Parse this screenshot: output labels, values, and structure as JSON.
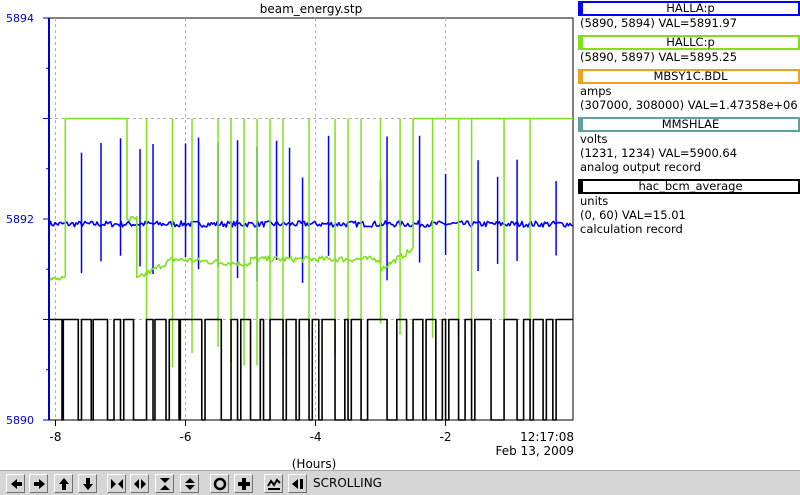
{
  "chart_data": {
    "type": "line",
    "title": "beam_energy.stp",
    "xlabel": "(Hours)",
    "x_ticks": [
      "-8",
      "-6",
      "-4",
      "-2"
    ],
    "y_ticks": [
      "5894",
      "5892",
      "5890"
    ],
    "ylim": [
      5890,
      5894
    ],
    "xlim": [
      -8.1,
      -0.04
    ],
    "grid": true,
    "time_label": "12:17:08",
    "date_label": "Feb 13, 2009",
    "axis_color": "#0000cc",
    "series": [
      {
        "name": "HALLA:p",
        "color": "#0000ff",
        "style": "noisy",
        "segments": [
          {
            "x": [
              -8.1,
              -0.04
            ],
            "y": [
              5891.95,
              5891.95
            ]
          }
        ],
        "spikes": [
          -7.6,
          -7.3,
          -7.0,
          -6.7,
          -6.5,
          -6.0,
          -5.8,
          -5.5,
          -5.2,
          -4.9,
          -4.6,
          -4.4,
          -4.2,
          -3.8,
          -3.0,
          -2.9,
          -2.4,
          -2.0,
          -1.5,
          -1.2,
          -0.9,
          -0.3
        ]
      },
      {
        "name": "HALLC:p",
        "color": "#80e020",
        "style": "noisy",
        "segments": [
          {
            "x": [
              -8.1,
              -7.85
            ],
            "y": [
              5891.4,
              5891.4
            ]
          },
          {
            "x": [
              -7.85,
              -6.9
            ],
            "y": [
              5893.0,
              5893.0
            ]
          },
          {
            "x": [
              -6.9,
              -6.75
            ],
            "y": [
              5892.0,
              5892.0
            ]
          },
          {
            "x": [
              -6.75,
              -6.2
            ],
            "y": [
              5891.4,
              5891.6
            ]
          },
          {
            "x": [
              -6.2,
              -5.0
            ],
            "y": [
              5891.6,
              5891.55
            ]
          },
          {
            "x": [
              -5.0,
              -3.0
            ],
            "y": [
              5891.6,
              5891.6
            ]
          },
          {
            "x": [
              -3.0,
              -2.5
            ],
            "y": [
              5891.5,
              5891.7
            ]
          },
          {
            "x": [
              -2.5,
              -0.04
            ],
            "y": [
              5893.0,
              5893.0
            ]
          }
        ],
        "spikes": [
          -6.6,
          -6.2,
          -5.9,
          -5.5,
          -5.3,
          -5.1,
          -4.9,
          -4.7,
          -4.5,
          -4.1,
          -3.7,
          -3.5,
          -3.3,
          -3.0,
          -2.7,
          -2.2,
          -1.8,
          -1.6,
          -1.1,
          -0.7
        ]
      },
      {
        "name": "hac_bcm_average",
        "color": "#000000",
        "style": "step",
        "high": 5891.0,
        "low": 5890.0,
        "dropouts": [
          [
            -7.9,
            -7.88
          ],
          [
            -7.65,
            -7.6
          ],
          [
            -7.45,
            -7.42
          ],
          [
            -7.2,
            -7.1
          ],
          [
            -7.0,
            -6.95
          ],
          [
            -6.8,
            -6.6
          ],
          [
            -6.5,
            -6.47
          ],
          [
            -6.3,
            -6.25
          ],
          [
            -6.1,
            -6.08
          ],
          [
            -5.75,
            -5.7
          ],
          [
            -5.45,
            -5.3
          ],
          [
            -5.2,
            -5.15
          ],
          [
            -5.0,
            -4.85
          ],
          [
            -4.8,
            -4.7
          ],
          [
            -4.5,
            -4.45
          ],
          [
            -4.3,
            -4.25
          ],
          [
            -4.1,
            -4.05
          ],
          [
            -3.95,
            -3.9
          ],
          [
            -3.7,
            -3.55
          ],
          [
            -3.5,
            -3.45
          ],
          [
            -3.3,
            -3.2
          ],
          [
            -2.9,
            -2.75
          ],
          [
            -2.6,
            -2.5
          ],
          [
            -2.35,
            -2.3
          ],
          [
            -2.15,
            -2.05
          ],
          [
            -2.0,
            -1.95
          ],
          [
            -1.8,
            -1.7
          ],
          [
            -1.6,
            -1.55
          ],
          [
            -1.3,
            -1.1
          ],
          [
            -0.9,
            -0.8
          ],
          [
            -0.7,
            -0.65
          ],
          [
            -0.5,
            -0.45
          ],
          [
            -0.35,
            -0.3
          ]
        ]
      }
    ]
  },
  "legend": [
    {
      "label": "HALLA:p",
      "color": "#0000ff",
      "lines": [
        "(5890, 5894) VAL=5891.97"
      ]
    },
    {
      "label": "HALLC:p",
      "color": "#80e020",
      "lines": [
        "(5890, 5897) VAL=5895.25"
      ]
    },
    {
      "label": "MBSY1C.BDL",
      "color": "#f0a020",
      "lines": [
        "amps",
        "(307000, 308000) VAL=1.47358e+06"
      ]
    },
    {
      "label": "MMSHLAE",
      "color": "#60a0a0",
      "lines": [
        "volts",
        "(1231, 1234) VAL=5900.64",
        "analog output record"
      ]
    },
    {
      "label": "hac_bcm_average",
      "color": "#000000",
      "lines": [
        "units",
        "(0, 60) VAL=15.01",
        "calculation record"
      ]
    }
  ],
  "toolbar": {
    "buttons": [
      "arrow-left-icon",
      "arrow-right-icon",
      "arrow-up-icon",
      "arrow-down-icon",
      "shrink-horizontal-icon",
      "expand-horizontal-icon",
      "shrink-vertical-icon",
      "expand-vertical-icon",
      "circle-icon",
      "plus-icon",
      "auto-scale-icon",
      "end-icon"
    ],
    "mode_label": "SCROLLING"
  }
}
